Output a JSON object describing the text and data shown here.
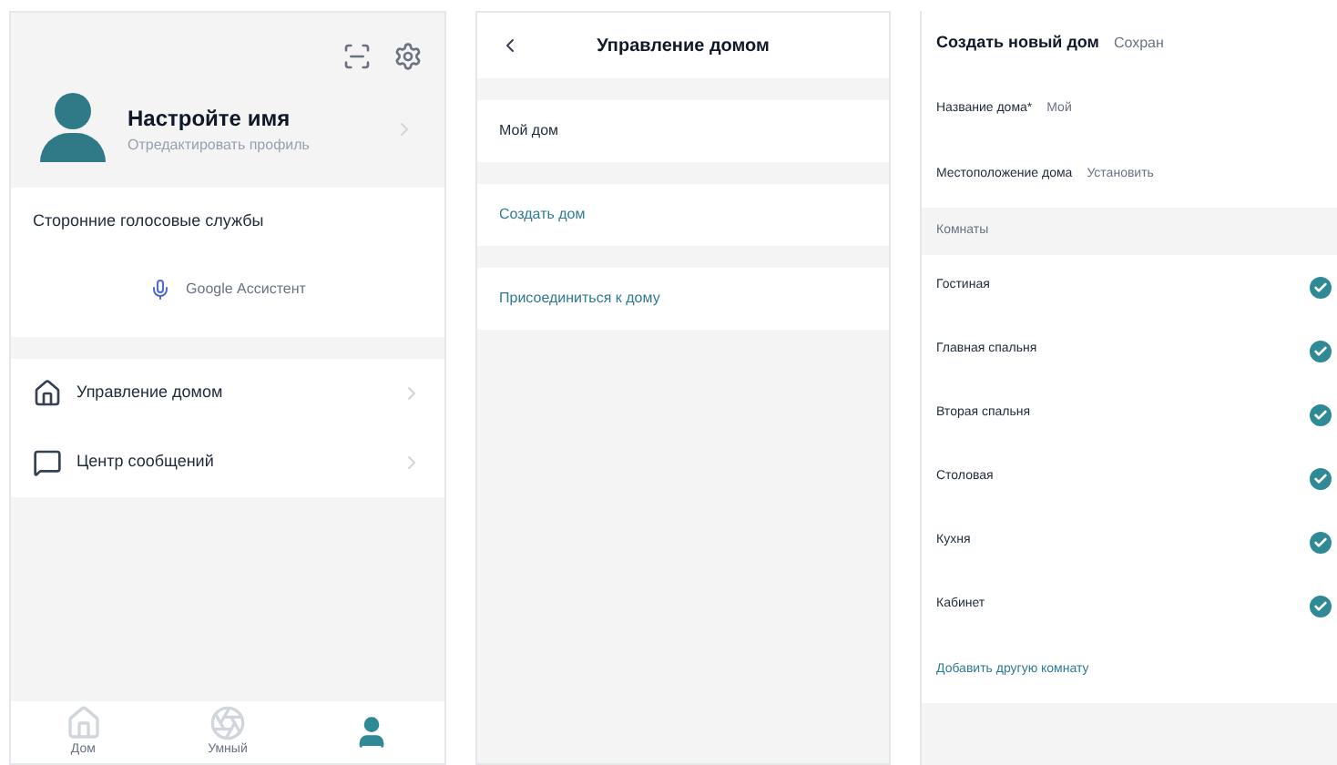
{
  "profile_screen": {
    "user": {
      "name": "Настройте имя",
      "subtitle": "Отредактировать профиль"
    },
    "services": {
      "title": "Сторонние голосовые службы",
      "button": "Google Ассистент"
    },
    "menu": [
      {
        "kind": "home",
        "label": "Управление домом"
      },
      {
        "kind": "message",
        "label": "Центр сообщений"
      }
    ],
    "tabs": [
      {
        "kind": "home",
        "label": "Дом",
        "selected": false
      },
      {
        "kind": "smart",
        "label": "Умный",
        "selected": false
      },
      {
        "kind": "user",
        "selected": true
      }
    ]
  },
  "home_management": {
    "title": "Управление домом",
    "items": [
      {
        "label": "Мой дом",
        "kind": "plain"
      },
      {
        "label": "Создать дом",
        "kind": "link"
      },
      {
        "label": "Присоединиться к дому",
        "kind": "link"
      }
    ]
  },
  "create_home": {
    "title": "Создать новый дом",
    "action": "Сохран",
    "fields": [
      {
        "label": "Название дома*",
        "value": "Мой"
      },
      {
        "label": "Местоположение дома",
        "value": "Установить"
      }
    ],
    "rooms_header": "Комнаты",
    "rooms": [
      {
        "label": "Гостиная",
        "checked": true
      },
      {
        "label": "Главная спальня",
        "checked": true
      },
      {
        "label": "Вторая спальня",
        "checked": true
      },
      {
        "label": "Столовая",
        "checked": true
      },
      {
        "label": "Кухня",
        "checked": true
      },
      {
        "label": "Кабинет",
        "checked": true
      }
    ],
    "add_room": "Добавить другую комнату"
  }
}
